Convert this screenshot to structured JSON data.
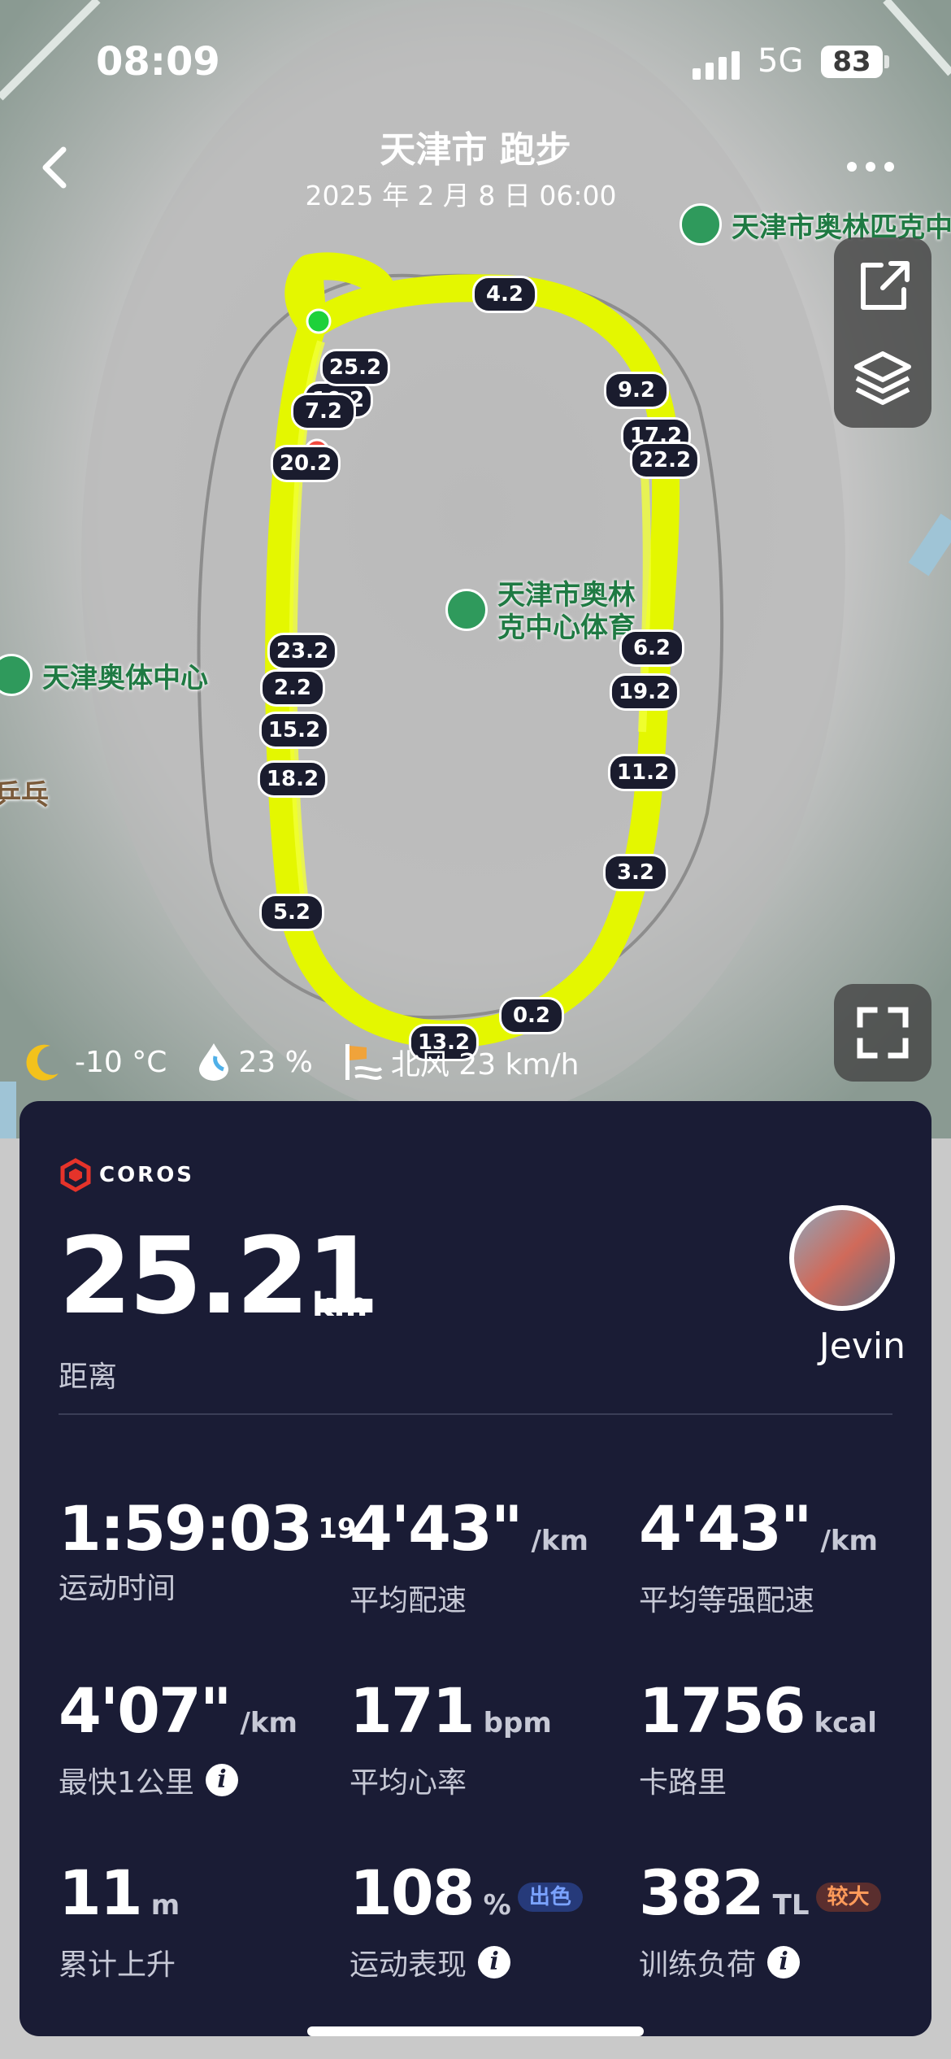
{
  "status_bar": {
    "time": "08:09",
    "network": "5G",
    "battery": "83"
  },
  "header": {
    "title": "天津市 跑步",
    "subtitle": "2025 年 2 月 8 日 06:00"
  },
  "map": {
    "pois": [
      {
        "id": "poi1",
        "label": "天津市奥林匹克中"
      },
      {
        "id": "poi2",
        "label": "天津市奥林\n克中心体育"
      },
      {
        "id": "poi3",
        "label": "天津奥体中心"
      },
      {
        "id": "poi4",
        "label": "乒乓"
      }
    ],
    "km_markers": [
      "4.2",
      "25.2",
      "10.2",
      "7.2",
      "20.2",
      "9.2",
      "17.2",
      "22.2",
      "6.2",
      "19.2",
      "23.2",
      "2.2",
      "15.2",
      "18.2",
      "11.2",
      "3.2",
      "5.2",
      "0.2",
      "13.2"
    ],
    "weather": {
      "temperature": "-10 °C",
      "humidity": "23 %",
      "wind": "北风 23 km/h"
    }
  },
  "card": {
    "brand": "COROS",
    "distance": {
      "value": "25.21",
      "unit": "km",
      "label": "距离"
    },
    "user": {
      "name": "Jevin"
    },
    "stats": {
      "duration": {
        "value": "1:59:03",
        "sup": "19",
        "label": "运动时间"
      },
      "avg_pace": {
        "value": "4'43\"",
        "unit": "/km",
        "label": "平均配速"
      },
      "grade_pace": {
        "value": "4'43\"",
        "unit": "/km",
        "label": "平均等强配速"
      },
      "fastest_km": {
        "value": "4'07\"",
        "unit": "/km",
        "label": "最快1公里"
      },
      "avg_hr": {
        "value": "171",
        "unit": "bpm",
        "label": "平均心率"
      },
      "calories": {
        "value": "1756",
        "unit": "kcal",
        "label": "卡路里"
      },
      "elevation": {
        "value": "11",
        "unit": "m",
        "label": "累计上升"
      },
      "performance": {
        "value": "108",
        "unit": "%",
        "badge": "出色",
        "label": "运动表现"
      },
      "training_load": {
        "value": "382",
        "unit": "TL",
        "badge": "较大",
        "label": "训练负荷"
      }
    }
  },
  "colors": {
    "route": "#e4f700",
    "card_bg": "#1a1c35",
    "poi_green": "#2f9a5c"
  },
  "icons": [
    "back-icon",
    "more-icon",
    "share-icon",
    "layers-icon",
    "fullscreen-icon",
    "moon-icon",
    "humidity-icon",
    "wind-icon",
    "info-icon",
    "coros-logo"
  ]
}
